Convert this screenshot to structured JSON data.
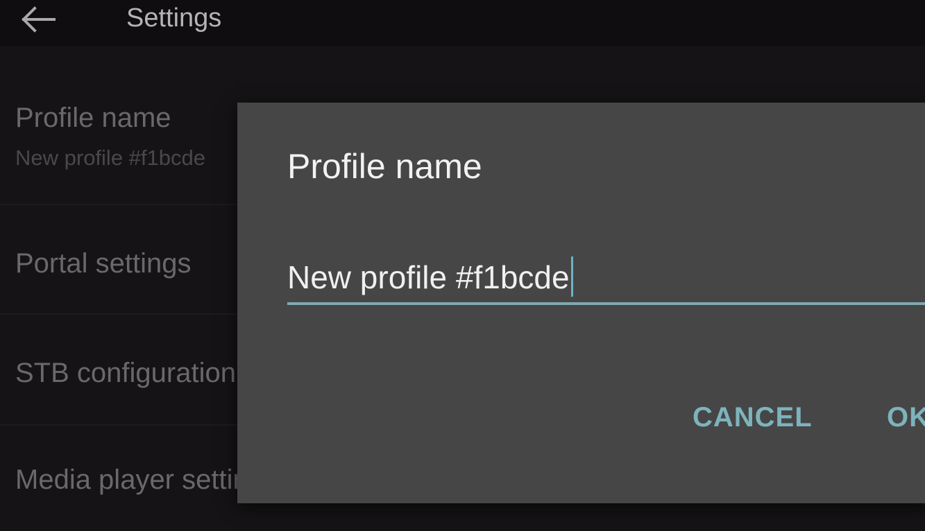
{
  "appbar": {
    "back_icon": "arrow-left-icon",
    "title": "Settings"
  },
  "settings_list": {
    "items": [
      {
        "primary": "Profile name",
        "secondary": "New profile #f1bcde"
      },
      {
        "primary": "Portal settings"
      },
      {
        "primary": "STB configuration"
      },
      {
        "primary": "Media player settings"
      }
    ]
  },
  "dialog": {
    "title": "Profile name",
    "input_value": "New profile #f1bcde",
    "cancel_label": "CANCEL",
    "ok_label": "OK"
  },
  "colors": {
    "background": "#151315",
    "dialog_background": "#464646",
    "accent": "#7db3bc"
  }
}
